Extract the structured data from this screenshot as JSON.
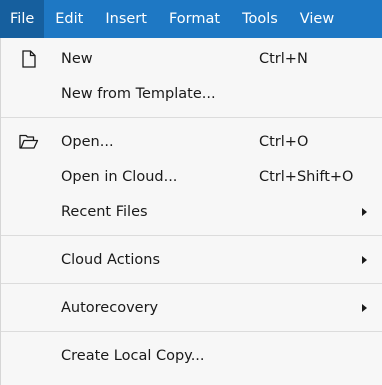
{
  "menubar": {
    "items": [
      {
        "label": "File"
      },
      {
        "label": "Edit"
      },
      {
        "label": "Insert"
      },
      {
        "label": "Format"
      },
      {
        "label": "Tools"
      },
      {
        "label": "View"
      }
    ]
  },
  "file_menu": {
    "new": {
      "label": "New",
      "shortcut": "Ctrl+N",
      "icon": "new-file-icon"
    },
    "new_from_template": {
      "label": "New from Template..."
    },
    "open": {
      "label": "Open...",
      "shortcut": "Ctrl+O",
      "icon": "folder-open-icon"
    },
    "open_in_cloud": {
      "label": "Open in Cloud...",
      "shortcut": "Ctrl+Shift+O"
    },
    "recent_files": {
      "label": "Recent Files"
    },
    "cloud_actions": {
      "label": "Cloud Actions"
    },
    "autorecovery": {
      "label": "Autorecovery"
    },
    "create_local_copy": {
      "label": "Create Local Copy..."
    }
  },
  "colors": {
    "menubar_bg": "#1e78c4",
    "menubar_active_bg": "#165f9e",
    "menu_bg": "#f7f7f7"
  }
}
